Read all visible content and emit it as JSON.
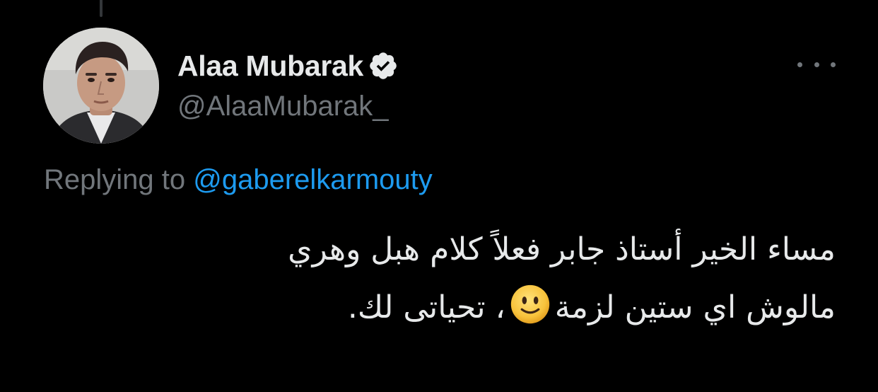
{
  "tweet": {
    "display_name": "Alaa Mubarak",
    "handle": "@AlaaMubarak_",
    "verified_icon": "verified-badge-icon",
    "more_icon": "more-options-icon",
    "replying_prefix": "Replying to",
    "replying_to": "@gaberelkarmouty",
    "text_line_1": "مساء الخير أستاذ جابر فعلاً كلام هبل وهري",
    "text_line_2_part_1": "مالوش اي ستين لزمة",
    "emoji": "🙂",
    "text_line_2_part_2": "، تحياتى لك."
  },
  "colors": {
    "background": "#000000",
    "primary_text": "#e7e9ea",
    "secondary_text": "#71767b",
    "link": "#1d9bf0",
    "thread_line": "#333639"
  }
}
